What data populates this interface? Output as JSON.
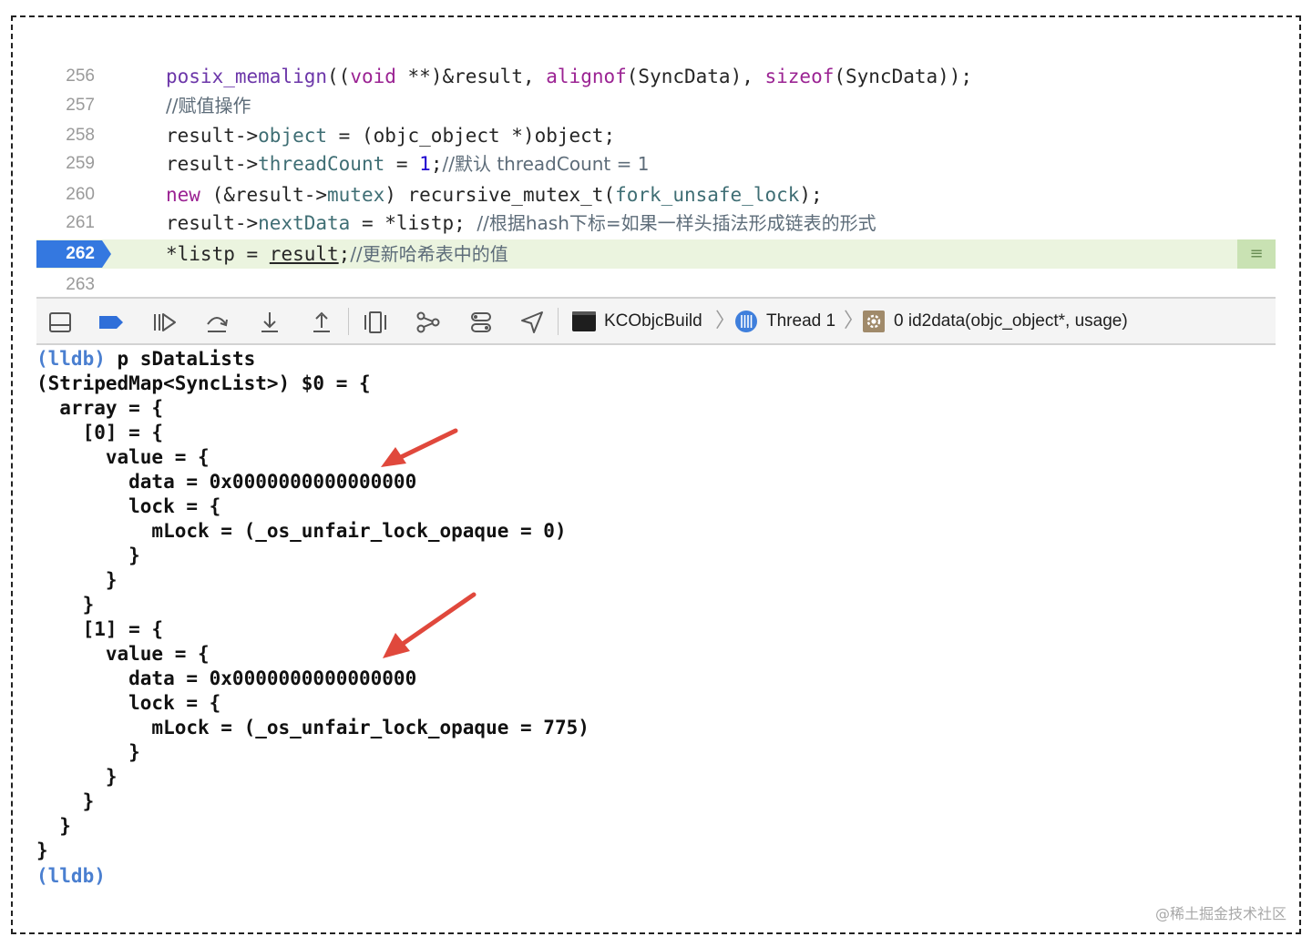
{
  "editor": {
    "lines": [
      {
        "num": "256"
      },
      {
        "num": "257"
      },
      {
        "num": "258"
      },
      {
        "num": "259"
      },
      {
        "num": "260"
      },
      {
        "num": "261"
      },
      {
        "num": "262"
      },
      {
        "num": "263"
      }
    ],
    "code": {
      "l256": [
        "posix_memalign",
        "((",
        "void",
        " **)&result, ",
        "alignof",
        "(SyncData), ",
        "sizeof",
        "(SyncData));"
      ],
      "l257": [
        "//赋值操作"
      ],
      "l258": [
        "result->",
        "object",
        " = (objc_object *)object;"
      ],
      "l259": [
        "result->",
        "threadCount",
        " = ",
        "1",
        ";",
        "//默认 threadCount = 1"
      ],
      "l260": [
        "new",
        " (&result->",
        "mutex",
        ") recursive_mutex_t(",
        "fork_unsafe_lock",
        ");"
      ],
      "l261": [
        "result->",
        "nextData",
        " = *listp; ",
        "//根据hash下标=如果一样头插法形成链表的形式"
      ],
      "l262": [
        "*listp = ",
        "result",
        ";",
        "//更新哈希表中的值"
      ]
    },
    "current_line": "262",
    "breakpoint_menu_glyph": "≡",
    "colors": {
      "current_line_bg": "#ebf4df",
      "badge": "#3478e0",
      "keyword": "#9b2393",
      "property": "#3f6e74"
    }
  },
  "debug_bar": {
    "icons": [
      "hide-debug-area-icon",
      "breakpoints-toggle-icon",
      "continue-icon",
      "step-over-icon",
      "step-into-icon",
      "step-out-icon",
      "debug-view-hierarchy-icon",
      "memory-graph-icon",
      "environment-overrides-icon",
      "simulate-location-icon"
    ],
    "breadcrumb": {
      "target": "KCObjcBuild",
      "thread": "Thread 1",
      "frame": "0 id2data(objc_object*, usage)"
    }
  },
  "console": {
    "prompt": "(lldb)",
    "command": "p sDataLists",
    "lines": [
      "(StripedMap<SyncList>) $0 = {",
      "  array = {",
      "    [0] = {",
      "      value = {",
      "        data = 0x0000000000000000",
      "        lock = {",
      "          mLock = (_os_unfair_lock_opaque = 0)",
      "        }",
      "      }",
      "    }",
      "    [1] = {",
      "      value = {",
      "        data = 0x0000000000000000",
      "        lock = {",
      "          mLock = (_os_unfair_lock_opaque = 775)",
      "        }",
      "      }",
      "    }",
      "  }",
      "}"
    ],
    "final_prompt": "(lldb)",
    "annotation_color": "#e0483c"
  },
  "watermark": "@稀土掘金技术社区"
}
